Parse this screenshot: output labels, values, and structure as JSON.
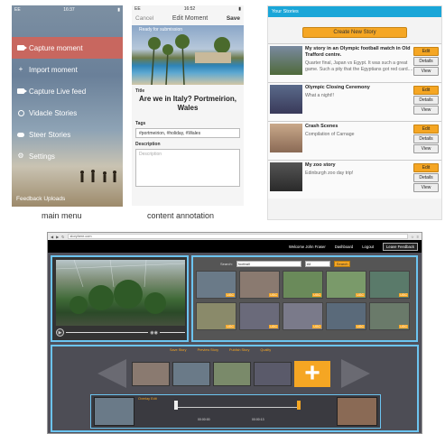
{
  "phone_menu": {
    "status": {
      "carrier": "EE",
      "time": "16:37"
    },
    "items": [
      {
        "label": "Capture moment",
        "icon": "camera-icon",
        "active": true
      },
      {
        "label": "Import moment",
        "icon": "plus-icon",
        "active": false
      },
      {
        "label": "Capture Live feed",
        "icon": "camera-icon",
        "active": false
      },
      {
        "label": "Vidacle Stories",
        "icon": "circle-icon",
        "active": false
      },
      {
        "label": "Steer Stories",
        "icon": "cloud-icon",
        "active": false
      },
      {
        "label": "Settings",
        "icon": "gear-icon",
        "active": false
      }
    ],
    "feedback": "Feedback  Uploads",
    "caption": "main menu"
  },
  "phone_edit": {
    "status": {
      "carrier": "EE",
      "time": "16:52"
    },
    "cancel": "Cancel",
    "title": "Edit Moment",
    "save": "Save",
    "photo_overlay": "Ready for submission",
    "title_label": "Title",
    "moment_title": "Are we in Italy? Portmeirion, Wales",
    "tags_label": "Tags",
    "tags_value": "#portmeirion, #holiday, #Wales",
    "description_label": "Description",
    "description_placeholder": "Description",
    "caption": "content annotation"
  },
  "stories_panel": {
    "header": "Your Stories",
    "create_button": "Create New Story",
    "stories": [
      {
        "title": "My story in an Olympic football match in Old Trafford centre.",
        "desc": "Quarter final, Japan vs Egypt. It was such a great game. Such a pity that the Egyptians got red card....",
        "btn_edit": "Edit",
        "btn_details": "Details",
        "btn_view": "View"
      },
      {
        "title": "Olympic Closing Ceremony",
        "desc": "What a night!!",
        "btn_edit": "Edit",
        "btn_details": "Details",
        "btn_view": "View"
      },
      {
        "title": "Crash Scenes",
        "desc": "Compilation of Carnage",
        "btn_edit": "Edit",
        "btn_details": "Details",
        "btn_view": "View"
      },
      {
        "title": "My zoo story",
        "desc": "Edinburgh zoo day trip!",
        "btn_edit": "Edit",
        "btn_details": "Details",
        "btn_view": "View"
      }
    ]
  },
  "desktop": {
    "address": "storyhere.com",
    "nav": {
      "welcome": "Welcome John Fraser",
      "dashboard": "Dashboard",
      "logout": "Logout",
      "feedback": "Leave Feedback"
    },
    "search": {
      "label": "Search:",
      "value": "football",
      "filter": "All",
      "button": "Search"
    },
    "ugc_badge": "UGC",
    "tiles": 15,
    "story_tabs": [
      "Save Story",
      "Preview Story",
      "Publish Story",
      "Quality"
    ],
    "editor_header": "Overlay Edit",
    "time_start": "00:00:00",
    "time_end": "00:00:13"
  }
}
